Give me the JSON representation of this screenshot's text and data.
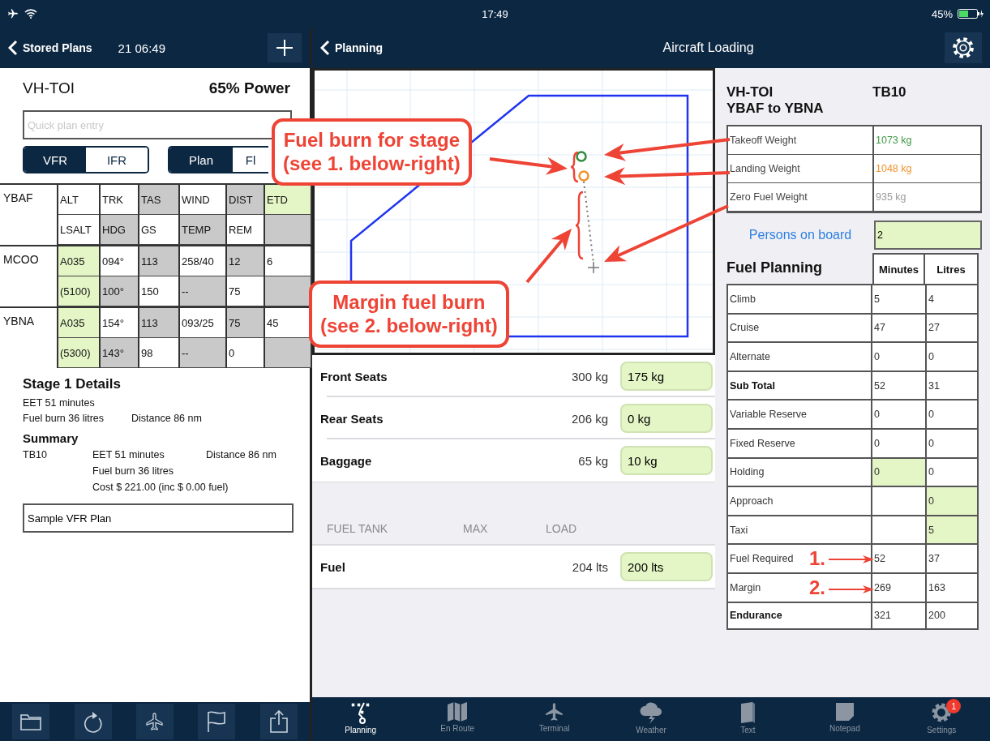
{
  "status_bar": {
    "time": "17:49",
    "battery": "45%"
  },
  "left_nav": {
    "back": "Stored Plans",
    "time": "21 06:49"
  },
  "plan": {
    "aircraft": "VH-TOI",
    "power": "65% Power",
    "quick_entry": {
      "placeholder": "Quick plan entry"
    },
    "rules_toggle": [
      {
        "label": "VFR",
        "selected": true
      },
      {
        "label": "IFR",
        "selected": false
      }
    ],
    "mode_toggle": [
      {
        "label": "Plan",
        "selected": true
      },
      {
        "label": "Fl",
        "selected": false
      }
    ],
    "legs": [
      {
        "waypoint": "YBAF",
        "rows": [
          [
            {
              "text": "ALT",
              "color": "#ffffff"
            },
            {
              "text": "TRK",
              "color": "#ffffff"
            },
            {
              "text": "TAS",
              "color": "#c9c9c9"
            },
            {
              "text": "WIND",
              "color": "#ffffff"
            },
            {
              "text": "DIST",
              "color": "#c9c9c9"
            },
            {
              "text": "ETD",
              "color": "#e4f5c6"
            }
          ],
          [
            {
              "text": "LSALT",
              "color": "#ffffff"
            },
            {
              "text": "HDG",
              "color": "#c9c9c9"
            },
            {
              "text": "GS",
              "color": "#ffffff"
            },
            {
              "text": "TEMP",
              "color": "#c9c9c9"
            },
            {
              "text": "REM",
              "color": "#ffffff"
            },
            {
              "color": "#c9c9c9"
            }
          ]
        ]
      },
      {
        "waypoint": "MCOO",
        "rows": [
          [
            {
              "text": "A035",
              "color": "#e4f5c6"
            },
            {
              "text": "094°",
              "color": "#ffffff"
            },
            {
              "text": "113",
              "color": "#c9c9c9"
            },
            {
              "text": "258/40",
              "color": "#ffffff"
            },
            {
              "text": "12",
              "color": "#c9c9c9"
            },
            {
              "text": "6",
              "color": "#ffffff"
            }
          ],
          [
            {
              "text": "(5100)",
              "color": "#e4f5c6"
            },
            {
              "text": "100°",
              "color": "#c9c9c9"
            },
            {
              "text": "150",
              "color": "#ffffff"
            },
            {
              "text": "--",
              "color": "#c9c9c9"
            },
            {
              "text": "75",
              "color": "#ffffff"
            },
            {
              "color": "#c9c9c9"
            }
          ]
        ]
      },
      {
        "waypoint": "YBNA",
        "rows": [
          [
            {
              "text": "A035",
              "color": "#e4f5c6"
            },
            {
              "text": "154°",
              "color": "#ffffff"
            },
            {
              "text": "113",
              "color": "#c9c9c9"
            },
            {
              "text": "093/25",
              "color": "#ffffff"
            },
            {
              "text": "75",
              "color": "#c9c9c9"
            },
            {
              "text": "45",
              "color": "#ffffff"
            }
          ],
          [
            {
              "text": "(5300)",
              "color": "#e4f5c6"
            },
            {
              "text": "143°",
              "color": "#c9c9c9"
            },
            {
              "text": "98",
              "color": "#ffffff"
            },
            {
              "text": "--",
              "color": "#c9c9c9"
            },
            {
              "text": "0",
              "color": "#ffffff"
            },
            {
              "color": "#c9c9c9"
            }
          ]
        ]
      }
    ],
    "stage_details": {
      "title": "Stage 1 Details",
      "eet": "EET 51 minutes",
      "fuel_burn": "Fuel burn 36 litres",
      "distance": "Distance 86 nm"
    },
    "summary": {
      "title": "Summary",
      "aircraft": "TB10",
      "eet": "EET 51 minutes",
      "distance": "Distance 86 nm",
      "fuel_burn": "Fuel burn 36 litres",
      "cost": "Cost $ 221.00 (inc $ 0.00 fuel)"
    },
    "notes": {
      "value": "Sample VFR Plan"
    }
  },
  "main_nav": {
    "back": "Planning",
    "title": "Aircraft Loading"
  },
  "loading": {
    "stations": [
      {
        "name": "Front Seats",
        "max": "300 kg",
        "load": "175 kg"
      },
      {
        "name": "Rear Seats",
        "max": "206 kg",
        "load": "0 kg"
      },
      {
        "name": "Baggage",
        "max": "65 kg",
        "load": "10 kg"
      }
    ],
    "fuel_header": [
      "FUEL TANK",
      "MAX",
      "LOAD"
    ],
    "tanks": [
      {
        "name": "Fuel",
        "max": "204 lts",
        "load": "200 lts"
      }
    ]
  },
  "summary_panel": {
    "aircraft": "VH-TOI",
    "route": "YBAF to YBNA",
    "type": "TB10",
    "weights": [
      {
        "label": "Takeoff Weight",
        "value": "1073 kg",
        "color": "#3f9a44"
      },
      {
        "label": "Landing Weight",
        "value": "1048 kg",
        "color": "#f0922e"
      },
      {
        "label": "Zero Fuel Weight",
        "value": "935 kg",
        "color": "#9a9a9a"
      }
    ],
    "persons_on_board": {
      "label": "Persons on board",
      "value": "2"
    },
    "fuel_planning": {
      "title": "Fuel Planning",
      "columns": [
        "Minutes",
        "Litres"
      ],
      "rows": [
        {
          "label": "Climb",
          "kind": "item",
          "cells": [
            {
              "text": "5",
              "editable": false
            },
            {
              "text": "4",
              "editable": false
            }
          ]
        },
        {
          "label": "Cruise",
          "kind": "item",
          "cells": [
            {
              "text": "47",
              "editable": false
            },
            {
              "text": "27",
              "editable": false
            }
          ]
        },
        {
          "label": "Alternate",
          "kind": "item",
          "cells": [
            {
              "text": "0",
              "editable": false
            },
            {
              "text": "0",
              "editable": false
            }
          ]
        },
        {
          "label": "Sub Total",
          "kind": "total",
          "cells": [
            {
              "text": "52",
              "editable": false
            },
            {
              "text": "31",
              "editable": false
            }
          ]
        },
        {
          "label": "Variable Reserve",
          "kind": "item",
          "cells": [
            {
              "text": "0",
              "editable": false
            },
            {
              "text": "0",
              "editable": false
            }
          ]
        },
        {
          "label": "Fixed Reserve",
          "kind": "item",
          "cells": [
            {
              "text": "0",
              "editable": false
            },
            {
              "text": "0",
              "editable": false
            }
          ]
        },
        {
          "label": "Holding",
          "kind": "item",
          "cells": [
            {
              "text": "0",
              "editable": true
            },
            {
              "text": "0",
              "editable": false
            }
          ]
        },
        {
          "label": "Approach",
          "kind": "item",
          "cells": [
            {
              "editable": false
            },
            {
              "text": "0",
              "editable": true
            }
          ]
        },
        {
          "label": "Taxi",
          "kind": "item",
          "cells": [
            {
              "editable": false
            },
            {
              "text": "5",
              "editable": true
            }
          ]
        },
        {
          "label": "Fuel Required",
          "kind": "item",
          "cells": [
            {
              "text": "52",
              "editable": false
            },
            {
              "text": "37",
              "editable": false
            }
          ]
        },
        {
          "label": "Margin",
          "kind": "item",
          "cells": [
            {
              "text": "269",
              "editable": false
            },
            {
              "text": "163",
              "editable": false
            }
          ]
        },
        {
          "label": "Endurance",
          "kind": "total",
          "cells": [
            {
              "text": "321",
              "editable": false
            },
            {
              "text": "200",
              "editable": false
            }
          ]
        }
      ]
    }
  },
  "tabs": [
    {
      "label": "Planning",
      "kind": "route",
      "selected": true
    },
    {
      "label": "En Route",
      "kind": "map",
      "selected": false
    },
    {
      "label": "Terminal",
      "kind": "plane",
      "selected": false
    },
    {
      "label": "Weather",
      "kind": "weather",
      "selected": false
    },
    {
      "label": "Text",
      "kind": "book",
      "selected": false
    },
    {
      "label": "Notepad",
      "kind": "note",
      "selected": false
    },
    {
      "label": "Settings",
      "kind": "gear",
      "selected": false,
      "badge": "1"
    }
  ],
  "annotations": {
    "callouts": [
      {
        "lines": [
          "Fuel burn for stage",
          "(see 1. below-right)"
        ]
      },
      {
        "lines": [
          "Margin fuel burn",
          "(see 2. below-right)"
        ]
      }
    ],
    "markers": [
      "1.",
      "2."
    ]
  }
}
